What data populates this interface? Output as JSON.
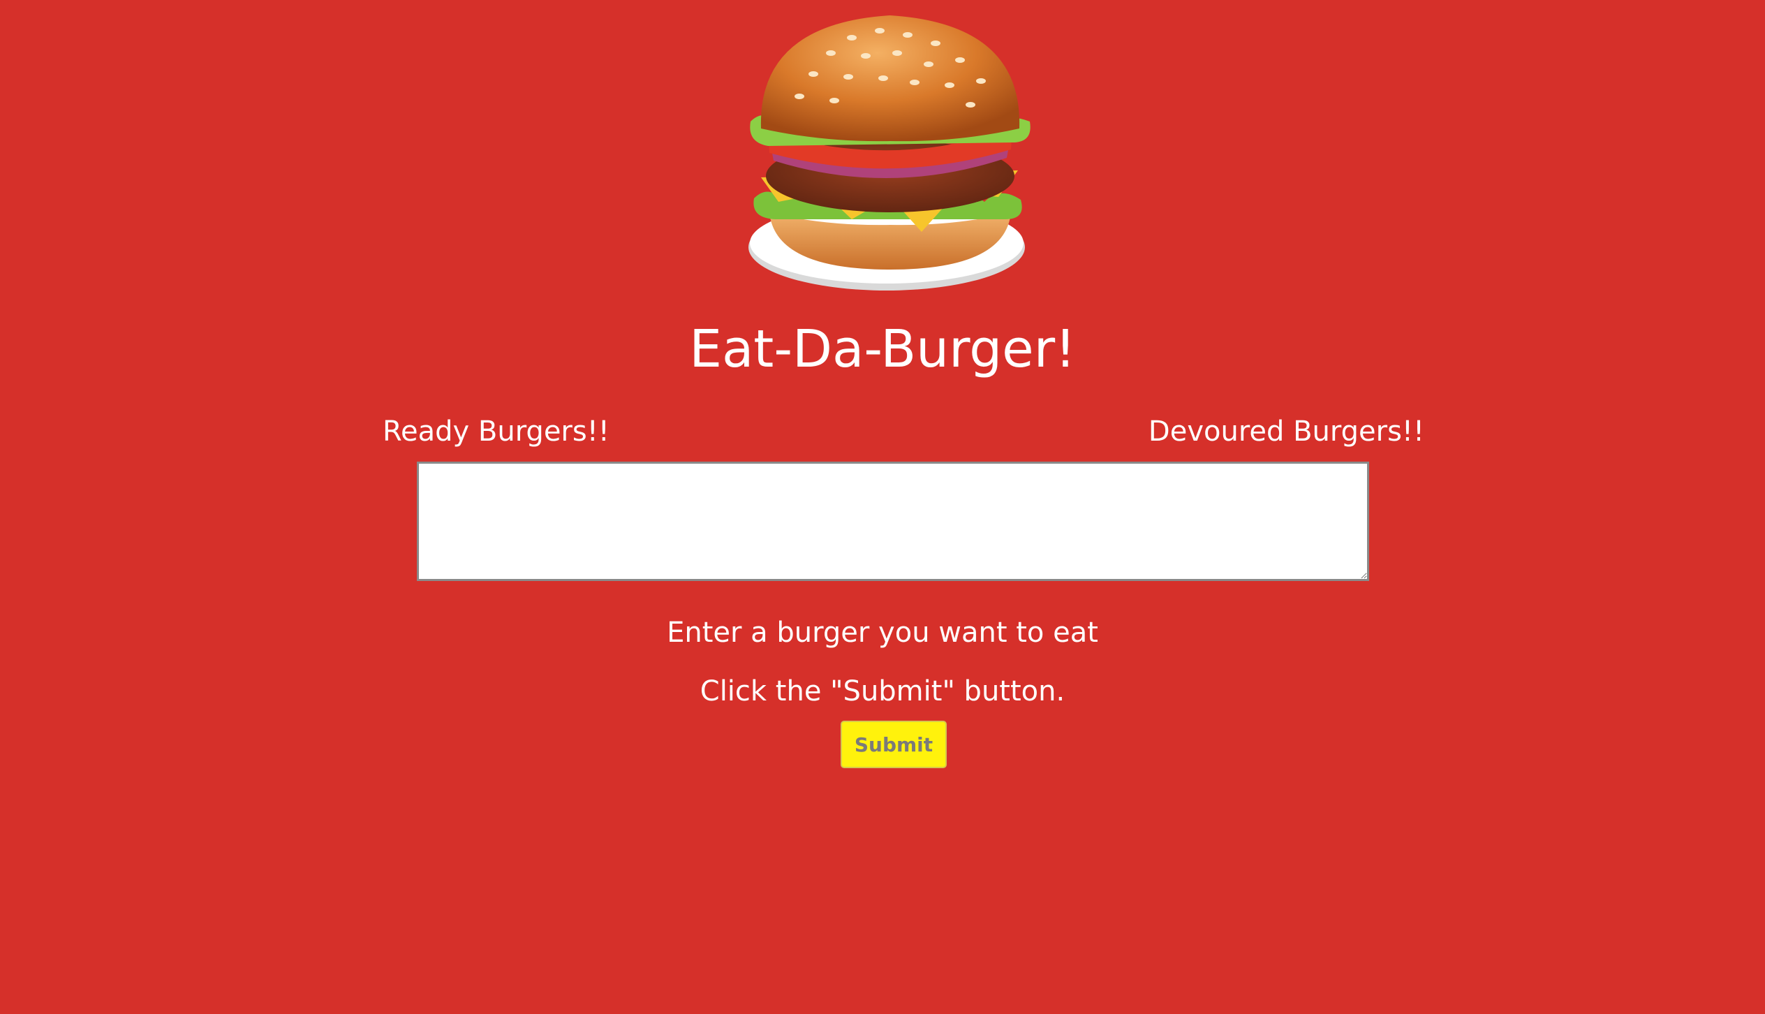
{
  "header": {
    "logo_icon": "burger-icon",
    "title": "Eat-Da-Burger!"
  },
  "columns": {
    "ready_label": "Ready Burgers!!",
    "devoured_label": "Devoured Burgers!!"
  },
  "form": {
    "burger_input_value": "",
    "instruction_1": "Enter a burger you want to eat",
    "instruction_2": "Click the \"Submit\" button.",
    "submit_label": "Submit"
  },
  "colors": {
    "background": "#d6302a",
    "button": "#fff20c",
    "text": "#ffffff"
  }
}
